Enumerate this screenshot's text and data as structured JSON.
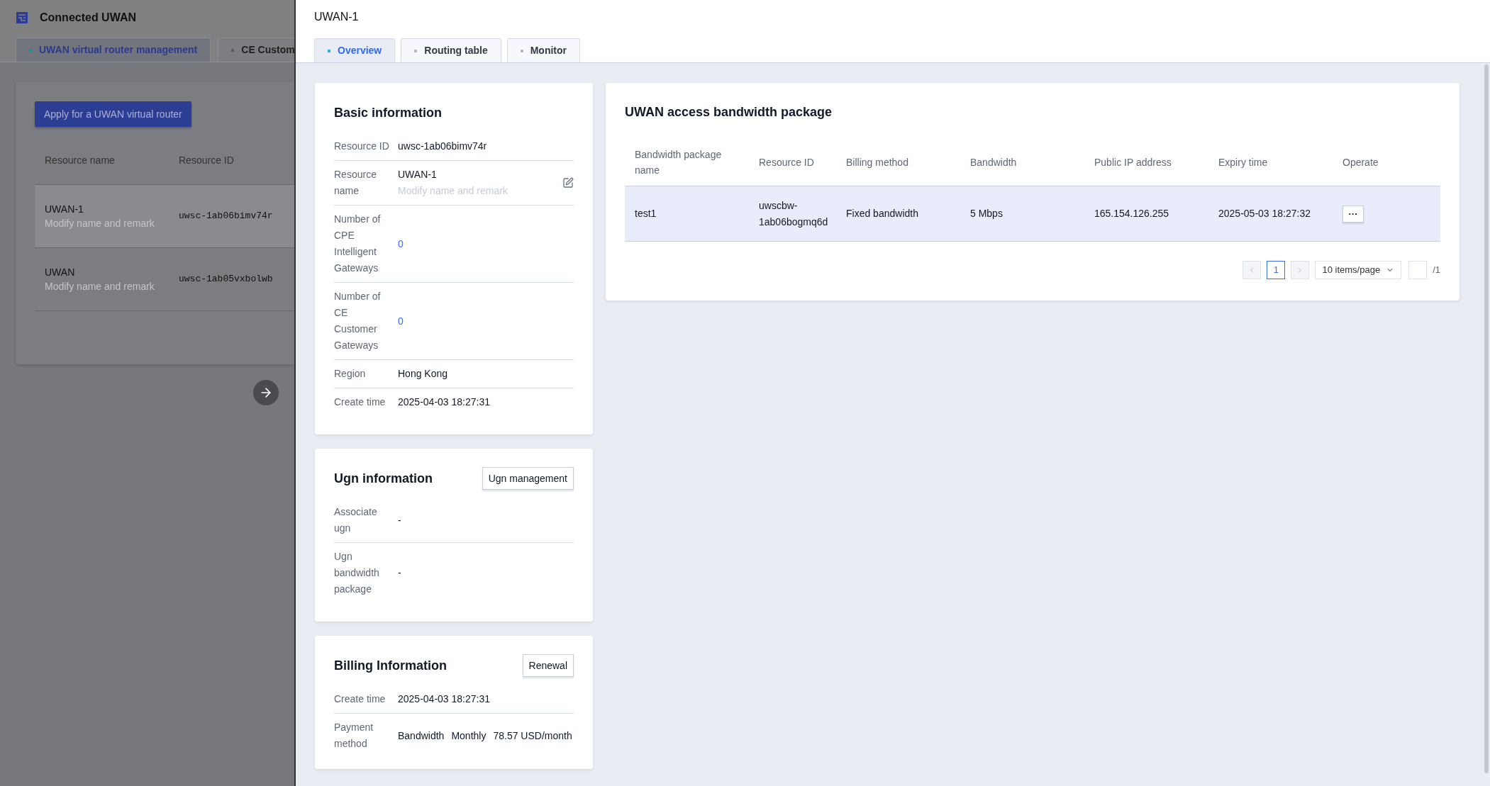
{
  "background_page": {
    "title": "Connected UWAN",
    "tabs": [
      {
        "label": "UWAN virtual router management",
        "selected": true
      },
      {
        "label": "CE Custom",
        "selected": false
      }
    ],
    "apply_button": "Apply for a UWAN virtual router",
    "table": {
      "columns": [
        "Resource name",
        "Resource ID"
      ],
      "rows": [
        {
          "name": "UWAN-1",
          "remark": "Modify name and remark",
          "resource_id": "uwsc-1ab06bimv74r",
          "highlighted": true
        },
        {
          "name": "UWAN",
          "remark": "Modify name and remark",
          "resource_id": "uwsc-1ab05vxbolwb",
          "highlighted": false
        }
      ]
    }
  },
  "drawer": {
    "title": "UWAN-1",
    "tabs": [
      {
        "label": "Overview",
        "selected": true
      },
      {
        "label": "Routing table",
        "selected": false
      },
      {
        "label": "Monitor",
        "selected": false
      }
    ],
    "basic_information": {
      "title": "Basic information",
      "rows": [
        {
          "kind": "text",
          "label": "Resource ID",
          "value": "uwsc-1ab06bimv74r"
        },
        {
          "kind": "editable",
          "label": "Resource name",
          "value": "UWAN-1",
          "remark": "Modify name and remark"
        },
        {
          "kind": "link",
          "label": "Number of CPE Intelligent Gateways",
          "value": "0"
        },
        {
          "kind": "link",
          "label": "Number of CE Customer Gateways",
          "value": "0"
        },
        {
          "kind": "text",
          "label": "Region",
          "value": "Hong Kong"
        },
        {
          "kind": "text",
          "label": "Create time",
          "value": "2025-04-03 18:27:31"
        }
      ]
    },
    "ugn_information": {
      "title": "Ugn information",
      "button": "Ugn management",
      "rows": [
        {
          "kind": "text",
          "label": "Associate ugn",
          "value": "-"
        },
        {
          "kind": "text",
          "label": "Ugn bandwidth package",
          "value": "-"
        }
      ]
    },
    "billing_information": {
      "title": "Billing Information",
      "button": "Renewal",
      "rows": [
        {
          "kind": "text",
          "label": "Create time",
          "value": "2025-04-03 18:27:31"
        },
        {
          "kind": "multi",
          "label": "Payment method",
          "values": [
            "Bandwidth",
            "Monthly",
            "78.57 USD/month"
          ]
        }
      ]
    },
    "bandwidth_package": {
      "title": "UWAN access bandwidth package",
      "columns": [
        "Bandwidth package name",
        "Resource ID",
        "Billing method",
        "Bandwidth",
        "Public IP address",
        "Expiry time",
        "Operate"
      ],
      "rows": [
        {
          "name": "test1",
          "resource_id": "uwscbw-1ab06bogmq6d",
          "billing_method": "Fixed bandwidth",
          "bandwidth": "5 Mbps",
          "public_ip": "165.154.126.255",
          "expiry_time": "2025-05-03 18:27:32",
          "operate": "···",
          "highlighted": true
        }
      ],
      "pagination": {
        "pages": [
          {
            "label": "1",
            "selected": true
          }
        ],
        "page_size": "10 items/page",
        "total_pages": "/1"
      }
    }
  }
}
